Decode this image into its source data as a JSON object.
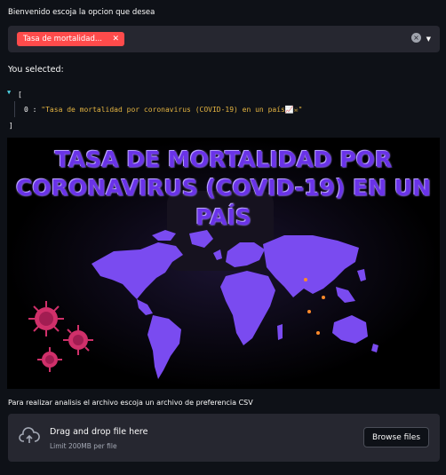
{
  "select_label": "Bienvenido escoja la opcion que desea",
  "multiselect": {
    "selected_tag": "Tasa de mortalidad...",
    "tag_close": "✕",
    "clear_icon": "clear-icon",
    "dropdown_icon": "chevron-down-icon",
    "tag_color": "#ff4b4b"
  },
  "you_selected": "You selected:",
  "json_view": {
    "open": "[",
    "close": "]",
    "index": "0",
    "value": "\"Tasa de mortalidad por coronavirus (COVID-19) en un país📈☠\""
  },
  "banner": {
    "line1": "TASA DE MORTALIDAD POR",
    "line2": "CORONAVIRUS (COVID-19) EN UN",
    "line3": "PAÍS",
    "accent": "#6a33e8"
  },
  "uploader": {
    "label": "Para realizar analisis el archivo escoja un archivo de preferencia CSV",
    "drag_text": "Drag and drop file here",
    "limit_text": "Limit 200MB per file",
    "browse_label": "Browse files",
    "icon": "cloud-upload-icon"
  }
}
